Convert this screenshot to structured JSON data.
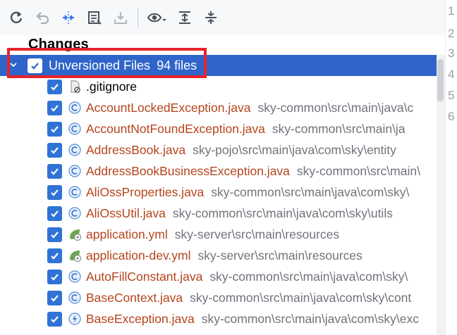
{
  "toolbar": {
    "buttons": [
      {
        "name": "refresh-button",
        "icon": "refresh-icon"
      },
      {
        "name": "rollback-button",
        "icon": "undo-icon"
      },
      {
        "name": "group-button",
        "icon": "collapse-arrows-icon"
      },
      {
        "name": "commit-message-button",
        "icon": "edit-box-icon"
      },
      {
        "name": "shelve-button",
        "icon": "download-tray-icon"
      },
      {
        "name": "view-options-button",
        "icon": "eye-icon"
      },
      {
        "name": "expand-all-button",
        "icon": "expand-all-icon"
      },
      {
        "name": "collapse-all-button",
        "icon": "collapse-all-icon"
      }
    ]
  },
  "changes_label": "Changes",
  "group": {
    "label": "Unversioned Files",
    "count": "94 files",
    "checked": true,
    "expanded": true
  },
  "gutter_lines": [
    "1",
    "2",
    "3",
    "4",
    "5",
    "6"
  ],
  "files": [
    {
      "name": ".gitignore",
      "path": "",
      "icon": "ignore-file-icon",
      "plain": true
    },
    {
      "name": "AccountLockedException.java",
      "path": "sky-common\\src\\main\\java\\c",
      "icon": "class-icon"
    },
    {
      "name": "AccountNotFoundException.java",
      "path": "sky-common\\src\\main\\ja",
      "icon": "class-icon"
    },
    {
      "name": "AddressBook.java",
      "path": "sky-pojo\\src\\main\\java\\com\\sky\\entity",
      "icon": "class-icon"
    },
    {
      "name": "AddressBookBusinessException.java",
      "path": "sky-common\\src\\main\\",
      "icon": "class-icon"
    },
    {
      "name": "AliOssProperties.java",
      "path": "sky-common\\src\\main\\java\\com\\sky\\",
      "icon": "class-icon"
    },
    {
      "name": "AliOssUtil.java",
      "path": "sky-common\\src\\main\\java\\com\\sky\\utils",
      "icon": "class-icon"
    },
    {
      "name": "application.yml",
      "path": "sky-server\\src\\main\\resources",
      "icon": "spring-config-icon"
    },
    {
      "name": "application-dev.yml",
      "path": "sky-server\\src\\main\\resources",
      "icon": "spring-config-icon"
    },
    {
      "name": "AutoFillConstant.java",
      "path": "sky-common\\src\\main\\java\\com\\sky\\",
      "icon": "class-icon"
    },
    {
      "name": "BaseContext.java",
      "path": "sky-common\\src\\main\\java\\com\\sky\\cont",
      "icon": "class-icon"
    },
    {
      "name": "BaseException.java",
      "path": "sky-common\\src\\main\\java\\com\\sky\\exc",
      "icon": "exception-class-icon"
    }
  ],
  "colors": {
    "selection": "#2f65ca",
    "checkbox": "#2f73d6",
    "unversioned_text": "#b5441d",
    "path_text": "#6f737a",
    "annotation": "#e7232a"
  }
}
